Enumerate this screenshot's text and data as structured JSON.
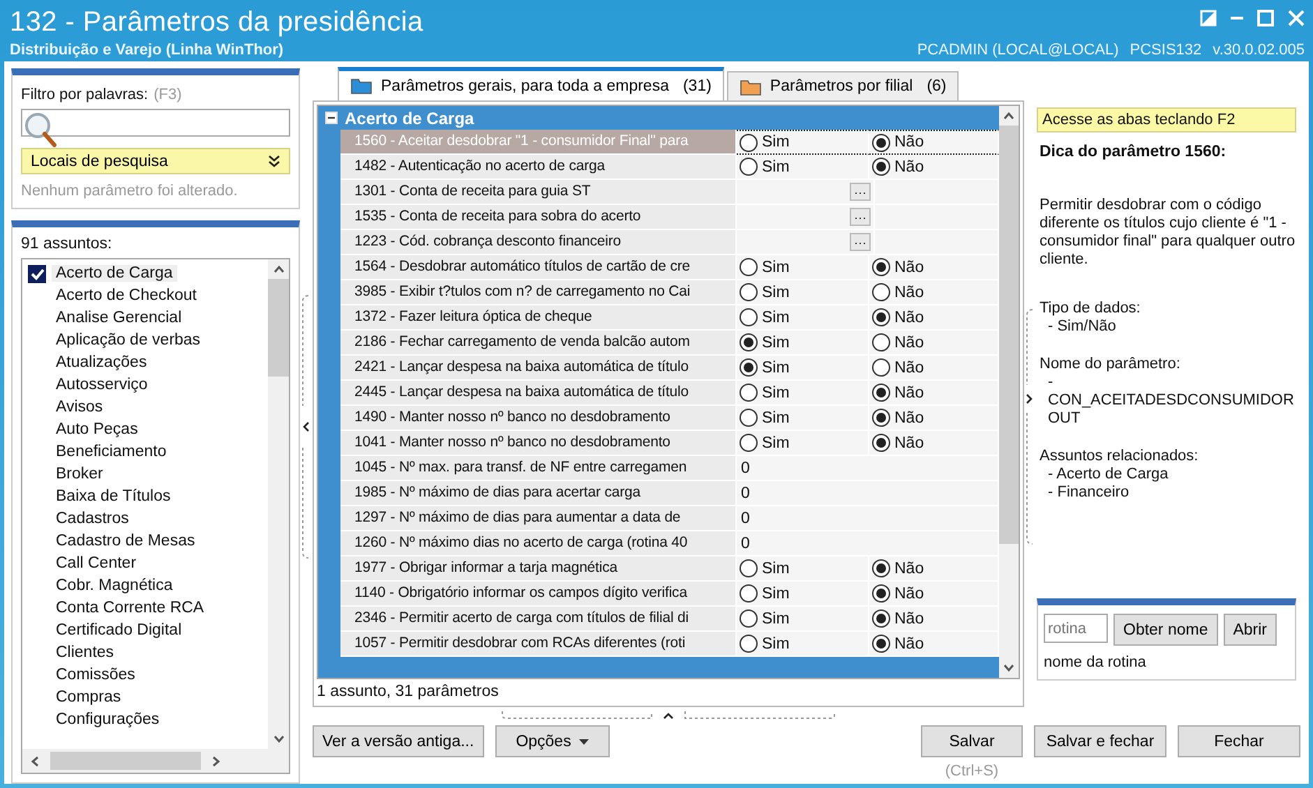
{
  "window": {
    "title": "132 - Parâmetros da presidência",
    "subtitle": "Distribuição e Varejo (Linha WinThor)",
    "user": "PCADMIN (LOCAL@LOCAL)",
    "program": "PCSIS132",
    "version": "v.30.0.02.005"
  },
  "filter": {
    "label": "Filtro por palavras:",
    "shortcut": "(F3)",
    "search_locations": "Locais de pesquisa",
    "status": "Nenhum parâmetro foi alterado."
  },
  "subjects": {
    "count": "91 assuntos:",
    "items": [
      {
        "label": "Acerto de Carga",
        "checked": true
      },
      {
        "label": "Acerto de Checkout",
        "checked": false
      },
      {
        "label": "Analise Gerencial",
        "checked": false
      },
      {
        "label": "Aplicação de verbas",
        "checked": false
      },
      {
        "label": "Atualizações",
        "checked": false
      },
      {
        "label": "Autosserviço",
        "checked": false
      },
      {
        "label": "Avisos",
        "checked": false
      },
      {
        "label": "Auto Peças",
        "checked": false
      },
      {
        "label": "Beneficiamento",
        "checked": false
      },
      {
        "label": "Broker",
        "checked": false
      },
      {
        "label": "Baixa de Títulos",
        "checked": false
      },
      {
        "label": "Cadastros",
        "checked": false
      },
      {
        "label": "Cadastro de Mesas",
        "checked": false
      },
      {
        "label": "Call Center",
        "checked": false
      },
      {
        "label": "Cobr. Magnética",
        "checked": false
      },
      {
        "label": "Conta Corrente RCA",
        "checked": false
      },
      {
        "label": "Certificado Digital",
        "checked": false
      },
      {
        "label": "Clientes",
        "checked": false
      },
      {
        "label": "Comissões",
        "checked": false
      },
      {
        "label": "Compras",
        "checked": false
      },
      {
        "label": "Configurações",
        "checked": false
      }
    ]
  },
  "tabs": [
    {
      "label": "Parâmetros gerais, para toda a empresa",
      "count": "(31)",
      "selected": true
    },
    {
      "label": "Parâmetros por filial",
      "count": "(6)",
      "selected": false
    }
  ],
  "grid": {
    "group": "Acerto de Carga",
    "rows": [
      {
        "kind": "bool",
        "label": "1560 - Aceitar desdobrar \"1 - consumidor Final\" para",
        "selected": true,
        "options": [
          {
            "label": "Sim",
            "selected": false
          },
          {
            "label": "Não",
            "selected": true
          }
        ]
      },
      {
        "kind": "bool",
        "label": "1482 - Autenticação no acerto de carga",
        "selected": false,
        "options": [
          {
            "label": "Sim",
            "selected": false
          },
          {
            "label": "Não",
            "selected": true
          }
        ]
      },
      {
        "kind": "lookup",
        "label": "1301 - Conta de receita para guia ST",
        "selected": false,
        "button": "···"
      },
      {
        "kind": "lookup",
        "label": "1535 - Conta de receita para sobra do acerto",
        "selected": false,
        "button": "···"
      },
      {
        "kind": "lookup",
        "label": "1223 - Cód. cobrança desconto financeiro",
        "selected": false,
        "button": "···"
      },
      {
        "kind": "bool",
        "label": "1564 - Desdobrar automático títulos de cartão de cre",
        "selected": false,
        "options": [
          {
            "label": "Sim",
            "selected": false
          },
          {
            "label": "Não",
            "selected": true
          }
        ]
      },
      {
        "kind": "bool",
        "label": "3985 - Exibir t?tulos com n? de carregamento no Cai",
        "selected": false,
        "options": [
          {
            "label": "Sim",
            "selected": false
          },
          {
            "label": "Não",
            "selected": false
          }
        ]
      },
      {
        "kind": "bool",
        "label": "1372 - Fazer leitura óptica de cheque",
        "selected": false,
        "options": [
          {
            "label": "Sim",
            "selected": false
          },
          {
            "label": "Não",
            "selected": true
          }
        ]
      },
      {
        "kind": "bool",
        "label": "2186 - Fechar carregamento de venda balcão autom",
        "selected": false,
        "options": [
          {
            "label": "Sim",
            "selected": true
          },
          {
            "label": "Não",
            "selected": false
          }
        ]
      },
      {
        "kind": "bool",
        "label": "2421 - Lançar despesa na baixa automática de título",
        "selected": false,
        "options": [
          {
            "label": "Sim",
            "selected": true
          },
          {
            "label": "Não",
            "selected": false
          }
        ]
      },
      {
        "kind": "bool",
        "label": "2445 - Lançar despesa na baixa automática de título",
        "selected": false,
        "options": [
          {
            "label": "Sim",
            "selected": false
          },
          {
            "label": "Não",
            "selected": true
          }
        ]
      },
      {
        "kind": "bool",
        "label": "1490 - Manter nosso nº banco no desdobramento",
        "selected": false,
        "options": [
          {
            "label": "Sim",
            "selected": false
          },
          {
            "label": "Não",
            "selected": true
          }
        ]
      },
      {
        "kind": "bool",
        "label": "1041 - Manter nosso nº banco no desdobramento",
        "selected": false,
        "options": [
          {
            "label": "Sim",
            "selected": false
          },
          {
            "label": "Não",
            "selected": true
          }
        ]
      },
      {
        "kind": "number",
        "label": "1045 - Nº max. para transf. de NF entre carregamen",
        "selected": false,
        "value": "0"
      },
      {
        "kind": "number",
        "label": "1985 - Nº máximo de dias para acertar carga",
        "selected": false,
        "value": "0"
      },
      {
        "kind": "number",
        "label": "1297 - Nº máximo de dias para aumentar a data de",
        "selected": false,
        "value": "0"
      },
      {
        "kind": "number",
        "label": "1260 - Nº máximo dias no acerto de carga (rotina 40",
        "selected": false,
        "value": "0"
      },
      {
        "kind": "bool",
        "label": "1977 - Obrigar informar a tarja magnética",
        "selected": false,
        "options": [
          {
            "label": "Sim",
            "selected": false
          },
          {
            "label": "Não",
            "selected": true
          }
        ]
      },
      {
        "kind": "bool",
        "label": "1140 - Obrigatório informar os campos dígito verifica",
        "selected": false,
        "options": [
          {
            "label": "Sim",
            "selected": false
          },
          {
            "label": "Não",
            "selected": true
          }
        ]
      },
      {
        "kind": "bool",
        "label": "2346 - Permitir acerto de carga com títulos de filial di",
        "selected": false,
        "options": [
          {
            "label": "Sim",
            "selected": false
          },
          {
            "label": "Não",
            "selected": true
          }
        ]
      },
      {
        "kind": "bool",
        "label": "1057 - Permitir desdobrar com RCAs diferentes (roti",
        "selected": false,
        "options": [
          {
            "label": "Sim",
            "selected": false
          },
          {
            "label": "Não",
            "selected": true
          }
        ]
      }
    ],
    "summary": "1 assunto, 31 parâmetros"
  },
  "help": {
    "hint": "Acesse as abas teclando F2",
    "title": "Dica do parâmetro 1560:",
    "description": "Permitir desdobrar com o código diferente os títulos cujo cliente é \"1 - consumidor final\" para qualquer outro cliente.",
    "sections": [
      {
        "heading": "Tipo de dados:",
        "lines": [
          "- Sim/Não"
        ]
      },
      {
        "heading": "Nome do parâmetro:",
        "lines": [
          "-",
          "CON_ACEITADESDCONSUMIDOROUT"
        ]
      },
      {
        "heading": "Assuntos relacionados:",
        "lines": [
          "- Acerto de Carga",
          "- Financeiro"
        ]
      }
    ]
  },
  "routine": {
    "placeholder": "rotina",
    "get_name": "Obter nome",
    "open": "Abrir",
    "name_label": "nome da rotina"
  },
  "buttons": {
    "old_version": "Ver a versão antiga...",
    "options": "Opções",
    "save": "Salvar",
    "save_shortcut": "(Ctrl+S)",
    "save_close": "Salvar e fechar",
    "close": "Fechar"
  }
}
